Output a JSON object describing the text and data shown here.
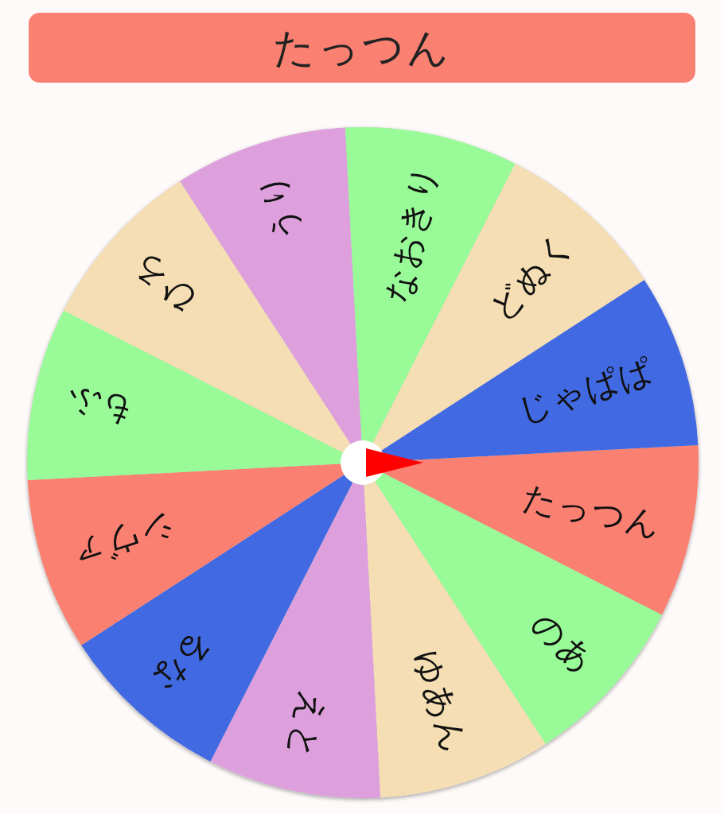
{
  "title": "たっつん",
  "segments": [
    {
      "label": "たっつん",
      "color": "#fa8072"
    },
    {
      "label": "のあ",
      "color": "#98fb98"
    },
    {
      "label": "ゆあん",
      "color": "#f5deb3"
    },
    {
      "label": "えと",
      "color": "#dda0dd"
    },
    {
      "label": "るな",
      "color": "#4169e1"
    },
    {
      "label": "シヴァ",
      "color": "#fa8072"
    },
    {
      "label": "もふ",
      "color": "#98fb98"
    },
    {
      "label": "ひろ",
      "color": "#f5deb3"
    },
    {
      "label": "うり",
      "color": "#dda0dd"
    },
    {
      "label": "なおきり",
      "color": "#98fb98"
    },
    {
      "label": "どぬく",
      "color": "#f5deb3"
    },
    {
      "label": "じゃぱぱ",
      "color": "#4169e1"
    }
  ]
}
